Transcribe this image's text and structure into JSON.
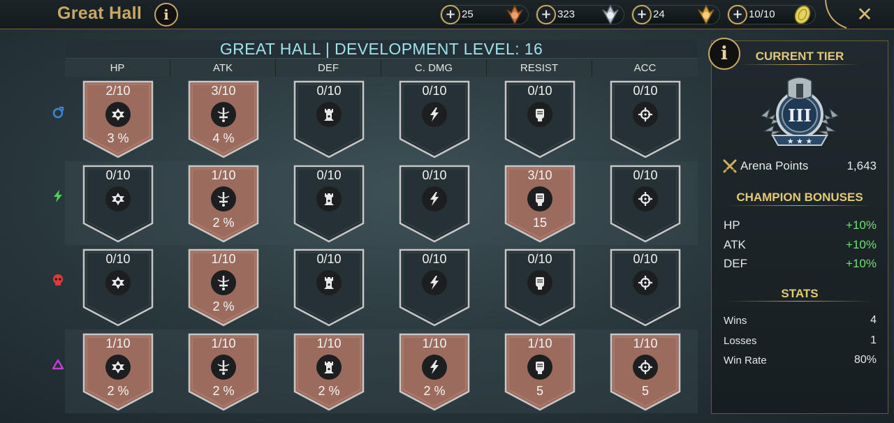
{
  "header": {
    "title": "Great Hall",
    "info_icon": "info-icon",
    "close_icon": "close-icon"
  },
  "resources": [
    {
      "value": "25",
      "icon": "bronze-medal-icon",
      "color": "#c8753a"
    },
    {
      "value": "323",
      "icon": "silver-medal-icon",
      "color": "#b8c4cc"
    },
    {
      "value": "24",
      "icon": "gold-medal-icon",
      "color": "#d9a741"
    },
    {
      "value": "10/10",
      "icon": "arena-token-icon",
      "color": "#e4d35a"
    }
  ],
  "grid": {
    "title": "GREAT HALL | DEVELOPMENT LEVEL: 16",
    "columns": [
      "HP",
      "ATK",
      "DEF",
      "C. DMG",
      "RESIST",
      "ACC"
    ],
    "column_icons": [
      "hp-emblem-icon",
      "atk-sword-icon",
      "def-tower-icon",
      "cdmg-lightning-icon",
      "resist-fist-icon",
      "acc-crosshair-icon"
    ],
    "rows": [
      {
        "affinity": "magic",
        "affinity_icon": "magic-affinity-icon",
        "affinity_color": "#3d86e0",
        "cells": [
          {
            "count": "2/10",
            "bonus": "3 %"
          },
          {
            "count": "3/10",
            "bonus": "4 %"
          },
          {
            "count": "0/10",
            "bonus": ""
          },
          {
            "count": "0/10",
            "bonus": ""
          },
          {
            "count": "0/10",
            "bonus": ""
          },
          {
            "count": "0/10",
            "bonus": ""
          }
        ]
      },
      {
        "affinity": "spirit",
        "affinity_icon": "spirit-affinity-icon",
        "affinity_color": "#47d452",
        "cells": [
          {
            "count": "0/10",
            "bonus": ""
          },
          {
            "count": "1/10",
            "bonus": "2 %"
          },
          {
            "count": "0/10",
            "bonus": ""
          },
          {
            "count": "0/10",
            "bonus": ""
          },
          {
            "count": "3/10",
            "bonus": "15"
          },
          {
            "count": "0/10",
            "bonus": ""
          }
        ]
      },
      {
        "affinity": "force",
        "affinity_icon": "force-affinity-icon",
        "affinity_color": "#e03a3a",
        "cells": [
          {
            "count": "0/10",
            "bonus": ""
          },
          {
            "count": "1/10",
            "bonus": "2 %"
          },
          {
            "count": "0/10",
            "bonus": ""
          },
          {
            "count": "0/10",
            "bonus": ""
          },
          {
            "count": "0/10",
            "bonus": ""
          },
          {
            "count": "0/10",
            "bonus": ""
          }
        ]
      },
      {
        "affinity": "void",
        "affinity_icon": "void-affinity-icon",
        "affinity_color": "#c23fd6",
        "cells": [
          {
            "count": "1/10",
            "bonus": "2 %"
          },
          {
            "count": "1/10",
            "bonus": "2 %"
          },
          {
            "count": "1/10",
            "bonus": "2 %"
          },
          {
            "count": "1/10",
            "bonus": "2 %"
          },
          {
            "count": "1/10",
            "bonus": "5"
          },
          {
            "count": "1/10",
            "bonus": "5"
          }
        ]
      }
    ]
  },
  "panel": {
    "current_tier_label": "CURRENT TIER",
    "tier_icon": "tier-iii-crest-icon",
    "tier_numeral": "III",
    "arena_points_label": "Arena Points",
    "arena_points_value": "1,643",
    "champion_bonuses_label": "CHAMPION BONUSES",
    "bonuses": [
      {
        "stat": "HP",
        "value": "+10%"
      },
      {
        "stat": "ATK",
        "value": "+10%"
      },
      {
        "stat": "DEF",
        "value": "+10%"
      }
    ],
    "stats_label": "STATS",
    "stats": [
      {
        "label": "Wins",
        "value": "4"
      },
      {
        "label": "Losses",
        "value": "1"
      },
      {
        "label": "Win Rate",
        "value": "80%"
      }
    ]
  },
  "colors": {
    "active_banner": "#9b6b5e",
    "inactive_banner": "#263135",
    "gold_accent": "#c9a865",
    "header_cyan": "#9ee2ee",
    "bonus_green": "#6ee26e"
  }
}
